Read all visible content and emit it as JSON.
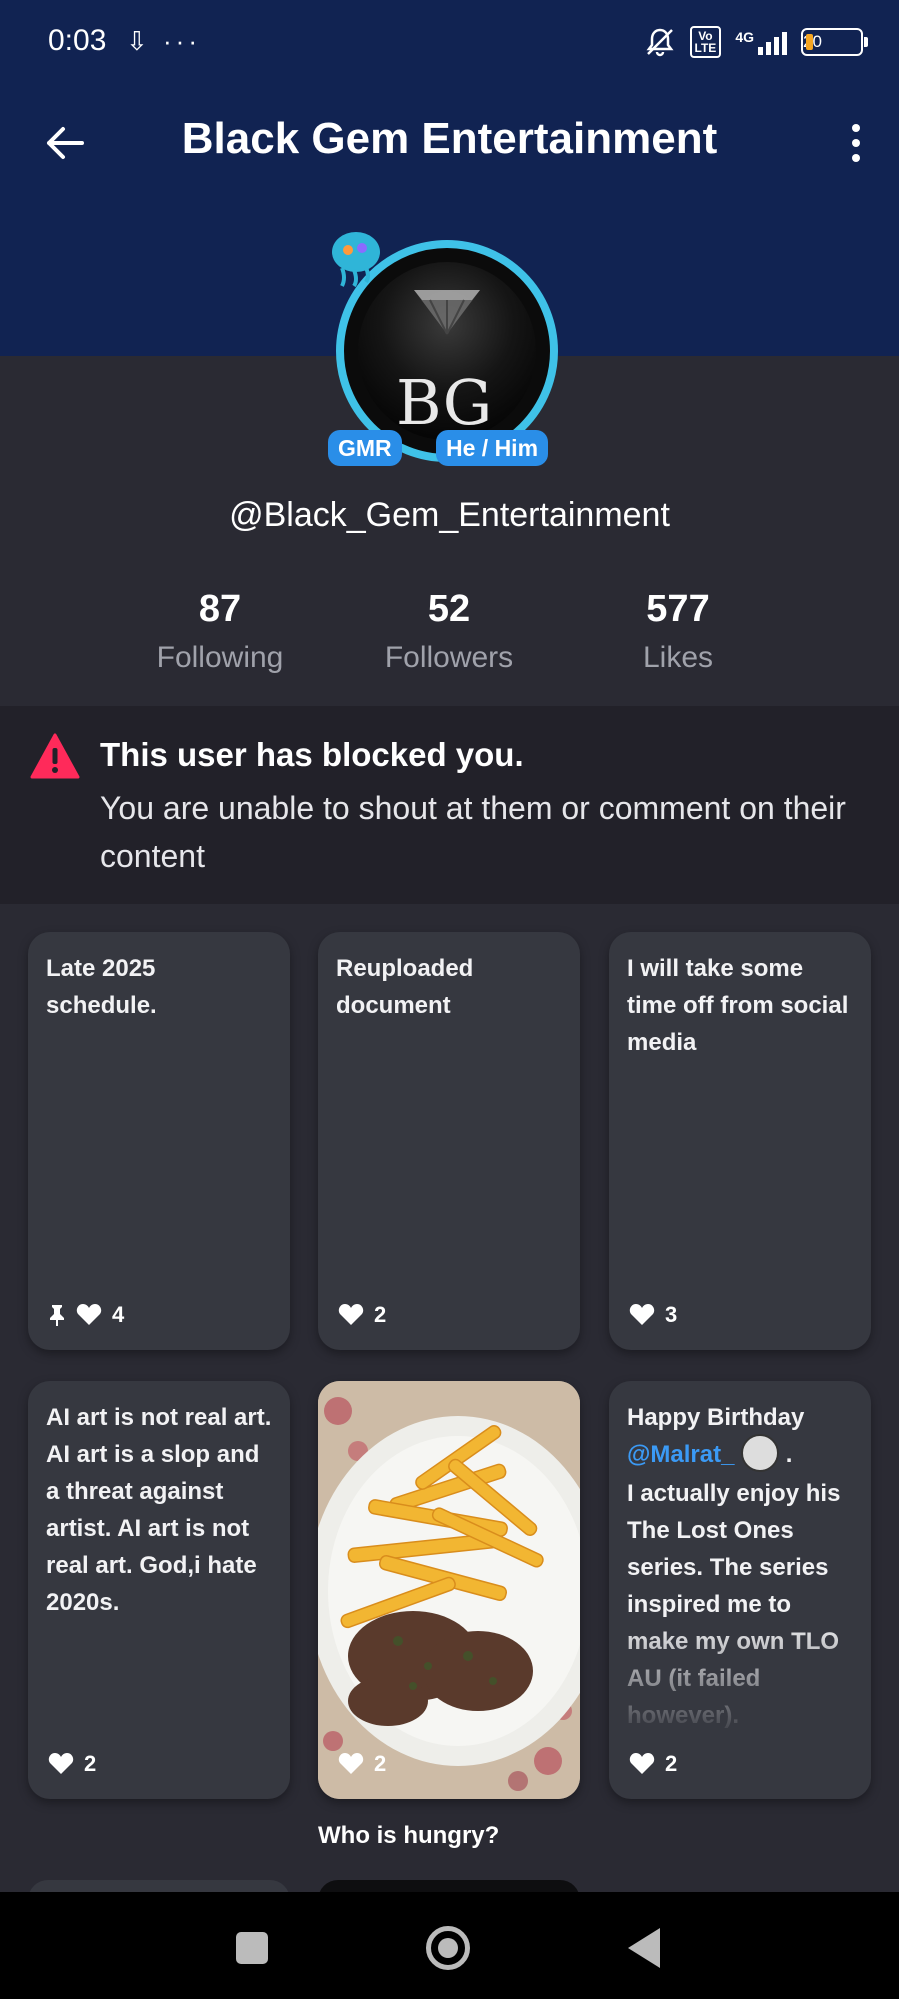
{
  "status_bar": {
    "time": "0:03",
    "left_icons": "⇩ ···",
    "network": "4G",
    "volte": "Vo\nLTE",
    "battery": "20"
  },
  "header": {
    "title": "Black Gem Entertainment"
  },
  "profile": {
    "avatar_initials": "BG",
    "badges": [
      "GMR",
      "He / Him"
    ],
    "username": "@Black_Gem_Entertainment",
    "stats": [
      {
        "value": "87",
        "label": "Following"
      },
      {
        "value": "52",
        "label": "Followers"
      },
      {
        "value": "577",
        "label": "Likes"
      }
    ]
  },
  "blocked_notice": {
    "title": "This user has blocked you.",
    "message": "You are unable to shout at them or comment on their content"
  },
  "posts": [
    {
      "text": "Late 2025 schedule.",
      "likes": "4",
      "pinned": true
    },
    {
      "text": "Reuploaded document",
      "likes": "2"
    },
    {
      "text": "I will take some time off from social media",
      "likes": "3"
    },
    {
      "text": "AI art is not real art. AI art is a slop and a threat against artist. AI art is not real art. God,i hate 2020s.",
      "likes": "2"
    },
    {
      "image": "food-photo",
      "caption": "Who is hungry?",
      "likes": "2"
    },
    {
      "text_before": "Happy Birthday",
      "mention": "@Malrat_",
      "text_after": "I actually enjoy his The Lost Ones series. The series inspired me to make my own TLO AU (it failed however).",
      "likes": "2"
    }
  ],
  "colors": {
    "header": "#112352",
    "background": "#2a2a33",
    "card": "#363840",
    "accent": "#2a8ee8",
    "warning": "#ff2a5a"
  }
}
